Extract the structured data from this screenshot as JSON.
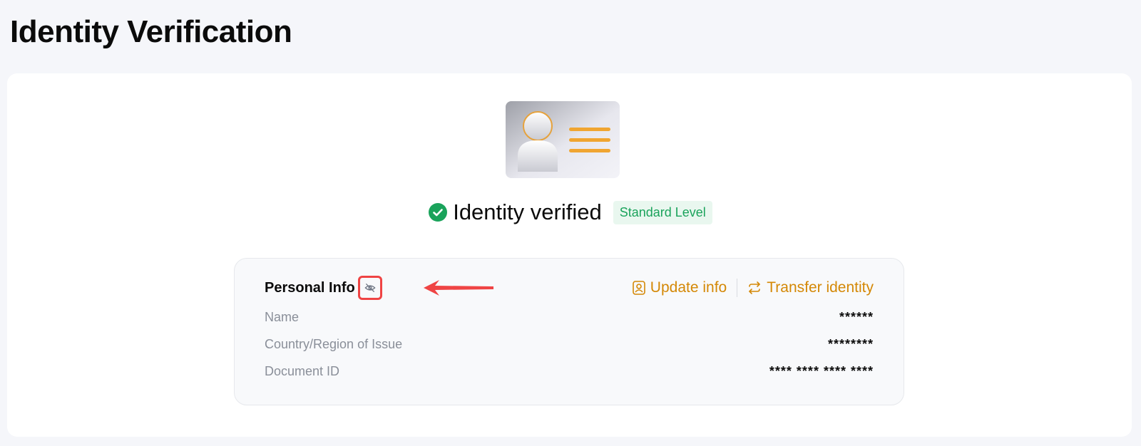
{
  "page": {
    "title": "Identity Verification"
  },
  "status": {
    "text": "Identity verified",
    "badge": "Standard Level",
    "check_icon": "check-circle-icon",
    "color": "#1aa35b"
  },
  "personal_info": {
    "title": "Personal Info",
    "visibility_icon": "eye-off-icon",
    "actions": [
      {
        "label": "Update info",
        "icon": "user-card-icon"
      },
      {
        "label": "Transfer identity",
        "icon": "transfer-icon"
      }
    ],
    "rows": [
      {
        "label": "Name",
        "value": "******"
      },
      {
        "label": "Country/Region of Issue",
        "value": "********"
      },
      {
        "label": "Document ID",
        "value": "**** **** **** ****"
      }
    ],
    "accent_color": "#d48806"
  },
  "annotation": {
    "highlight_color": "#ef4444"
  }
}
